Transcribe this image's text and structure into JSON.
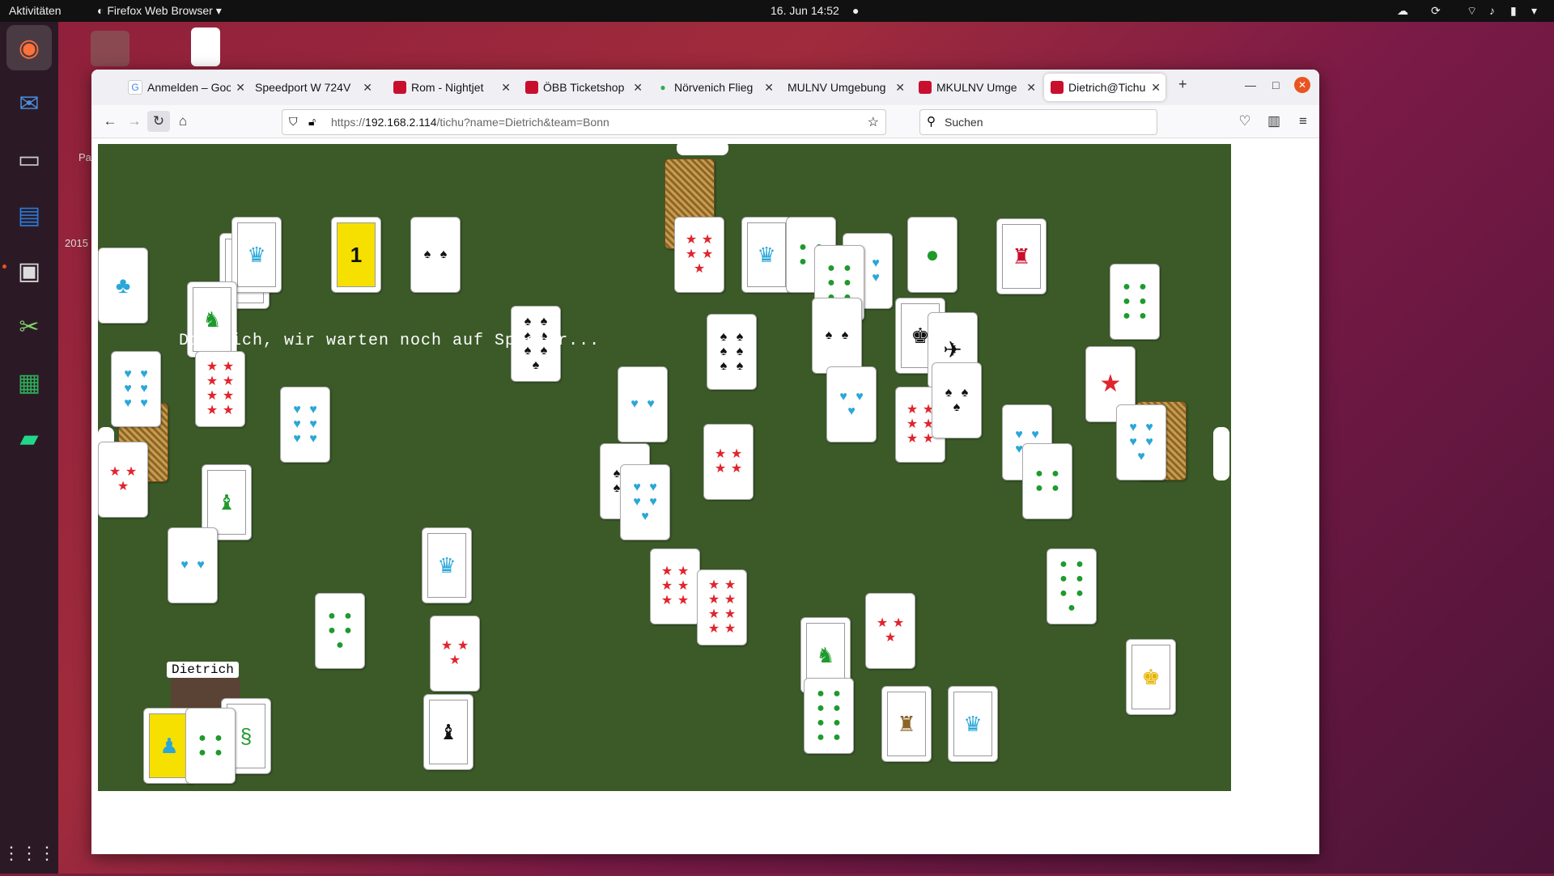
{
  "topbar": {
    "activities": "Aktivitäten",
    "app": "Firefox Web Browser",
    "datetime": "16. Jun  14:52"
  },
  "dock": {
    "items": [
      "firefox-icon",
      "thunderbird-icon",
      "files-icon",
      "writer-icon",
      "monitor-icon",
      "scissors-icon",
      "calc-icon",
      "pycharm-icon"
    ],
    "apps_grid": "⋮⋮⋮"
  },
  "desktop": {
    "side_text_1": "Pa",
    "side_text_2": "2015"
  },
  "browser": {
    "tabs": [
      {
        "label": "Anmelden – Goo",
        "fav_color": "#4285f4"
      },
      {
        "label": "Speedport W 724V",
        "fav_color": ""
      },
      {
        "label": "Rom - Nightjet",
        "fav_color": "#c8102e"
      },
      {
        "label": "ÖBB Ticketshop",
        "fav_color": "#c8102e"
      },
      {
        "label": "Nörvenich Flieg",
        "fav_color": "#34a853"
      },
      {
        "label": "MULNV Umgebung",
        "fav_color": ""
      },
      {
        "label": "MKULNV Umge",
        "fav_color": "#c8102e"
      },
      {
        "label": "Dietrich@Tichu",
        "fav_color": "#c8102e"
      }
    ],
    "new_tab": "+",
    "url_prefix": "https://",
    "url_host": "192.168.2.114",
    "url_path": "/tichu?name=Dietrich&team=Bonn",
    "search_placeholder": "Suchen"
  },
  "game": {
    "wait_message": "Dietrich, wir warten noch auf Spieler...",
    "player_name": "Dietrich",
    "colors": {
      "board": "#3b5a28",
      "red": "#e0242c",
      "blue": "#2aa7d8",
      "green": "#1f9a2c",
      "black": "#111111"
    }
  }
}
